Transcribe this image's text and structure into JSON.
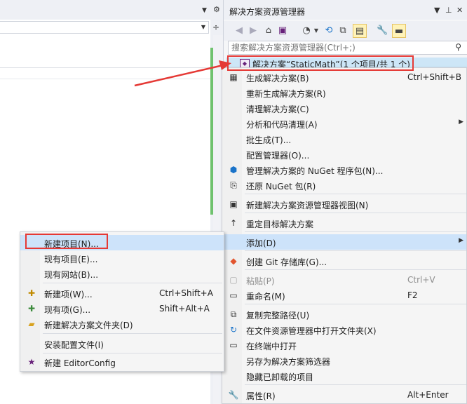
{
  "solution_explorer": {
    "title": "解决方案资源管理器",
    "search_placeholder": "搜索解决方案资源管理器(Ctrl+;)",
    "solution_label": "解决方案“StaticMath”(1 个项目/共 1 个)"
  },
  "context_menu": {
    "items": [
      {
        "label": "生成解决方案(B)",
        "shortcut": "Ctrl+Shift+B",
        "icon": "build-icon"
      },
      {
        "label": "重新生成解决方案(R)"
      },
      {
        "label": "清理解决方案(C)"
      },
      {
        "label": "分析和代码清理(A)",
        "submenu": true
      },
      {
        "label": "批生成(T)..."
      },
      {
        "label": "配置管理器(O)..."
      },
      {
        "label": "管理解决方案的 NuGet 程序包(N)...",
        "icon": "nuget-icon"
      },
      {
        "label": "还原 NuGet 包(R)",
        "icon": "restore-icon"
      },
      {
        "label": "新建解决方案资源管理器视图(N)",
        "icon": "new-view-icon"
      },
      {
        "label": "重定目标解决方案",
        "icon": "retarget-icon"
      },
      {
        "label": "添加(D)",
        "submenu": true
      },
      {
        "label": "创建 Git 存储库(G)...",
        "icon": "git-icon"
      },
      {
        "label": "粘贴(P)",
        "shortcut": "Ctrl+V",
        "disabled": true,
        "icon": "paste-icon"
      },
      {
        "label": "重命名(M)",
        "shortcut": "F2",
        "icon": "rename-icon"
      },
      {
        "label": "复制完整路径(U)",
        "icon": "copy-path-icon"
      },
      {
        "label": "在文件资源管理器中打开文件夹(X)",
        "icon": "open-folder-icon"
      },
      {
        "label": "在终端中打开",
        "icon": "terminal-icon"
      },
      {
        "label": "另存为解决方案筛选器"
      },
      {
        "label": "隐藏已卸载的项目"
      },
      {
        "label": "属性(R)",
        "shortcut": "Alt+Enter",
        "icon": "wrench-icon"
      }
    ]
  },
  "add_submenu": {
    "items": [
      {
        "label": "新建项目(N)..."
      },
      {
        "label": "现有项目(E)..."
      },
      {
        "label": "现有网站(B)..."
      },
      {
        "label": "新建项(W)...",
        "shortcut": "Ctrl+Shift+A",
        "icon": "new-item-icon"
      },
      {
        "label": "现有项(G)...",
        "shortcut": "Shift+Alt+A",
        "icon": "existing-item-icon"
      },
      {
        "label": "新建解决方案文件夹(D)",
        "icon": "solution-folder-icon"
      },
      {
        "label": "安装配置文件(I)"
      },
      {
        "label": "新建 EditorConfig",
        "icon": "editorconfig-icon"
      }
    ]
  },
  "colors": {
    "highlight": "#cde3fa",
    "annotation_red": "#e53935",
    "solution_selected": "#cde6f7"
  }
}
